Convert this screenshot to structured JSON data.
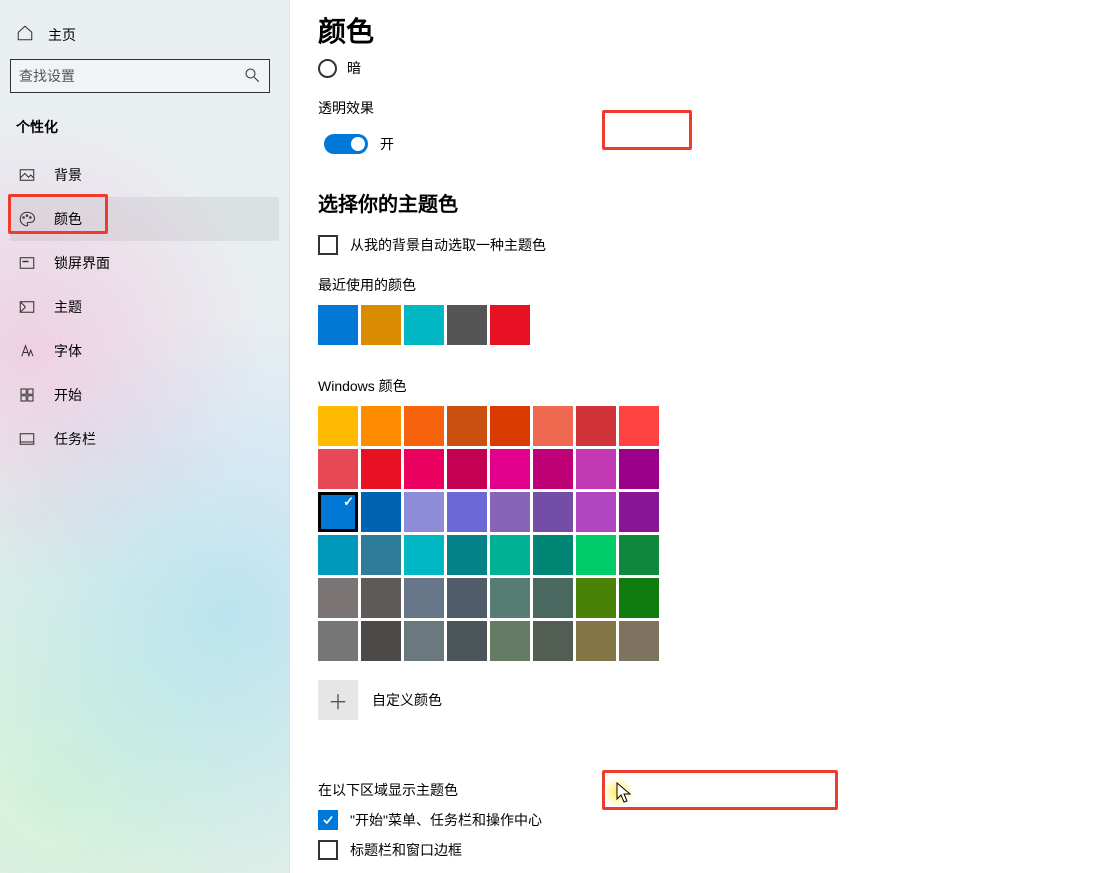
{
  "sidebar": {
    "home_label": "主页",
    "search_placeholder": "查找设置",
    "section_title": "个性化",
    "items": [
      {
        "label": "背景",
        "icon": "image"
      },
      {
        "label": "颜色",
        "icon": "palette"
      },
      {
        "label": "锁屏界面",
        "icon": "lock-screen"
      },
      {
        "label": "主题",
        "icon": "theme"
      },
      {
        "label": "字体",
        "icon": "font"
      },
      {
        "label": "开始",
        "icon": "start"
      },
      {
        "label": "任务栏",
        "icon": "taskbar"
      }
    ]
  },
  "page": {
    "title": "颜色",
    "mode_option": "暗",
    "transparency_label": "透明效果",
    "transparency_value": "开",
    "choose_accent_heading": "选择你的主题色",
    "auto_pick_label": "从我的背景自动选取一种主题色",
    "recent_colors_label": "最近使用的颜色",
    "recent_colors": [
      "#0078d4",
      "#d98c00",
      "#00b7c3",
      "#555555",
      "#e81123"
    ],
    "windows_colors_label": "Windows 颜色",
    "windows_colors": [
      "#ffb900",
      "#ff8c00",
      "#f7630c",
      "#ca5010",
      "#da3b01",
      "#ef6950",
      "#d13438",
      "#ff4343",
      "#e74856",
      "#e81123",
      "#ea005e",
      "#c30052",
      "#e3008c",
      "#bf0077",
      "#c239b3",
      "#9a0089",
      "#0078d4",
      "#0063b1",
      "#8e8cd8",
      "#6b69d6",
      "#8764b8",
      "#744da9",
      "#b146c2",
      "#881798",
      "#0099bc",
      "#2d7d9a",
      "#00b7c3",
      "#038387",
      "#00b294",
      "#018574",
      "#00cc6a",
      "#10893e",
      "#7a7574",
      "#5d5a58",
      "#68768a",
      "#515c6b",
      "#567c73",
      "#486860",
      "#498205",
      "#107c10",
      "#767676",
      "#4c4a48",
      "#69797e",
      "#4a5459",
      "#647c64",
      "#525e54",
      "#847545",
      "#7e735f"
    ],
    "selected_color_index": 16,
    "custom_color_label": "自定义颜色",
    "surfaces_heading": "在以下区域显示主题色",
    "surfaces": [
      {
        "label": "\"开始\"菜单、任务栏和操作中心",
        "checked": true
      },
      {
        "label": "标题栏和窗口边框",
        "checked": false
      }
    ]
  }
}
